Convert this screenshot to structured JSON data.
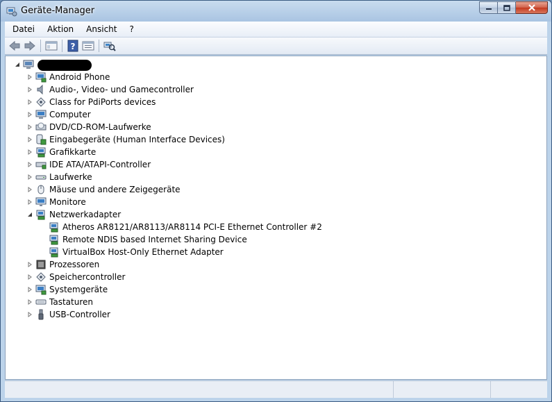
{
  "window": {
    "title": "Geräte-Manager"
  },
  "menu": [
    "Datei",
    "Aktion",
    "Ansicht",
    "?"
  ],
  "toolbar": {
    "buttons": [
      "back-icon",
      "forward-icon",
      "show-hide-console-tree-icon",
      "help-icon",
      "properties-icon",
      "scan-hardware-icon"
    ]
  },
  "tree": {
    "root_icon": "computer-icon",
    "categories": [
      {
        "label": "Android Phone",
        "icon": "android-phone-icon",
        "expanded": false
      },
      {
        "label": "Audio-, Video- und Gamecontroller",
        "icon": "speaker-icon",
        "expanded": false
      },
      {
        "label": "Class for PdiPorts devices",
        "icon": "ports-icon",
        "expanded": false
      },
      {
        "label": "Computer",
        "icon": "computer-icon",
        "expanded": false
      },
      {
        "label": "DVD/CD-ROM-Laufwerke",
        "icon": "dvd-drive-icon",
        "expanded": false
      },
      {
        "label": "Eingabegeräte (Human Interface Devices)",
        "icon": "hid-icon",
        "expanded": false
      },
      {
        "label": "Grafikkarte",
        "icon": "display-adapter-icon",
        "expanded": false
      },
      {
        "label": "IDE ATA/ATAPI-Controller",
        "icon": "ide-controller-icon",
        "expanded": false
      },
      {
        "label": "Laufwerke",
        "icon": "disk-drive-icon",
        "expanded": false
      },
      {
        "label": "Mäuse und andere Zeigegeräte",
        "icon": "mouse-icon",
        "expanded": false
      },
      {
        "label": "Monitore",
        "icon": "monitor-icon",
        "expanded": false
      },
      {
        "label": "Netzwerkadapter",
        "icon": "network-adapter-icon",
        "expanded": true,
        "children": [
          {
            "label": "Atheros AR8121/AR8113/AR8114 PCI-E Ethernet Controller #2",
            "icon": "network-adapter-icon"
          },
          {
            "label": "Remote NDIS based Internet Sharing Device",
            "icon": "network-adapter-icon"
          },
          {
            "label": "VirtualBox Host-Only Ethernet Adapter",
            "icon": "network-adapter-icon"
          }
        ]
      },
      {
        "label": "Prozessoren",
        "icon": "processor-icon",
        "expanded": false
      },
      {
        "label": "Speichercontroller",
        "icon": "storage-controller-icon",
        "expanded": false
      },
      {
        "label": "Systemgeräte",
        "icon": "system-device-icon",
        "expanded": false
      },
      {
        "label": "Tastaturen",
        "icon": "keyboard-icon",
        "expanded": false
      },
      {
        "label": "USB-Controller",
        "icon": "usb-icon",
        "expanded": false
      }
    ]
  }
}
